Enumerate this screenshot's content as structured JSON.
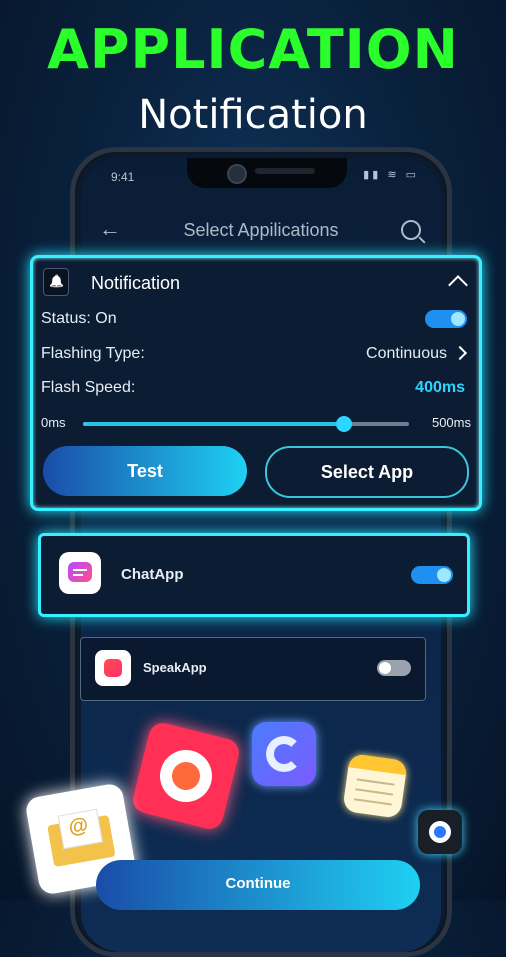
{
  "hero": {
    "title": "APPLICATION",
    "subtitle": "Notification"
  },
  "status_bar": {
    "time": "9:41",
    "indicators": "▮▮ ≋ ▭"
  },
  "app_bar": {
    "back_icon": "arrow-left-icon",
    "title": "Select Appilications",
    "search_icon": "search-icon"
  },
  "notification_card": {
    "title": "Notification",
    "rows": {
      "status_label": "Status: On",
      "status_on": true,
      "flashing_label": "Flashing Type:",
      "flashing_value": "Continuous",
      "speed_label": "Flash Speed:",
      "speed_value": "400ms"
    },
    "slider": {
      "min_label": "0ms",
      "max_label": "500ms",
      "value_fraction": 0.8
    },
    "test_label": "Test",
    "select_app_label": "Select App"
  },
  "apps": [
    {
      "name": "ChatApp",
      "enabled": true
    },
    {
      "name": "SpeakApp",
      "enabled": false
    }
  ],
  "continue_label": "Continue",
  "colors": {
    "hero_green": "#2bff2b",
    "accent_cyan": "#37f0ff",
    "toggle_on": "#1f8ff0"
  }
}
